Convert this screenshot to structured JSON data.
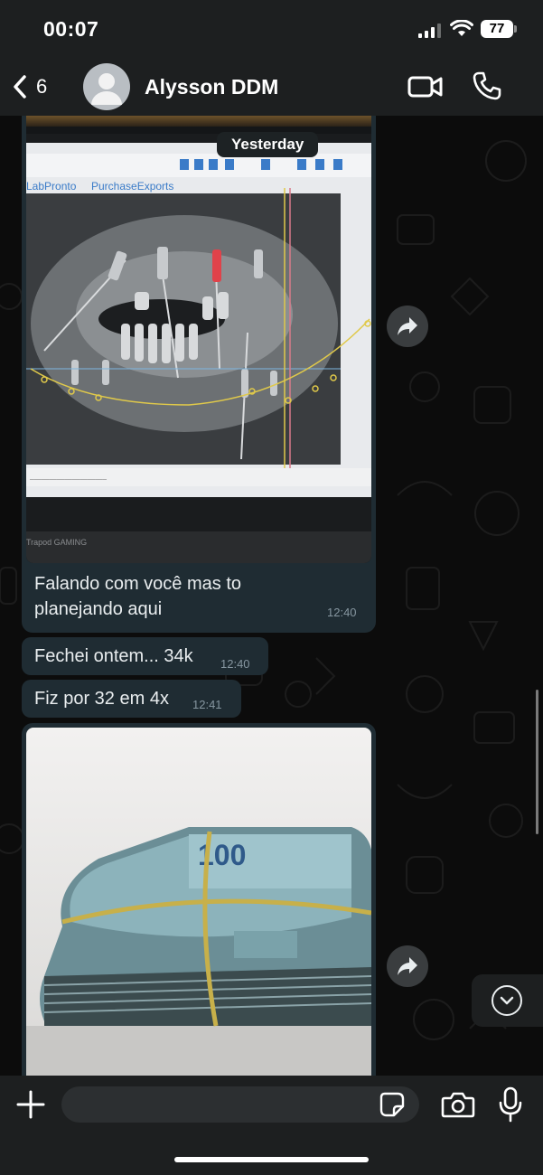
{
  "status_bar": {
    "time": "00:07",
    "battery": "77"
  },
  "header": {
    "back_count": "6",
    "contact_name": "Alysson DDM"
  },
  "chat": {
    "date_chip": "Yesterday",
    "messages": [
      {
        "type": "image",
        "caption": "Falando com você mas to planejando aqui",
        "time": "12:40",
        "screen_text": {
          "app_name": "LabPronto",
          "brand": "PurchaseExports",
          "laptop_brand": "Trapod GAMING"
        }
      },
      {
        "type": "text",
        "text": "Fechei ontem... 34k",
        "time": "12:40"
      },
      {
        "type": "text",
        "text": "Fiz por 32 em 4x",
        "time": "12:41"
      },
      {
        "type": "image",
        "banknote_value": "100"
      }
    ]
  },
  "input": {
    "placeholder": ""
  },
  "icons": {
    "back": "chevron-left-icon",
    "video": "video-camera-icon",
    "call": "phone-icon",
    "forward": "forward-arrow-icon",
    "scroll_down": "chevron-down-icon",
    "attach": "plus-icon",
    "sticker": "sticker-icon",
    "camera": "camera-icon",
    "mic": "microphone-icon"
  },
  "colors": {
    "bubble": "#1f2c33",
    "bar": "#1d1f20",
    "meta": "#8696a0",
    "text": "#e9edef"
  }
}
